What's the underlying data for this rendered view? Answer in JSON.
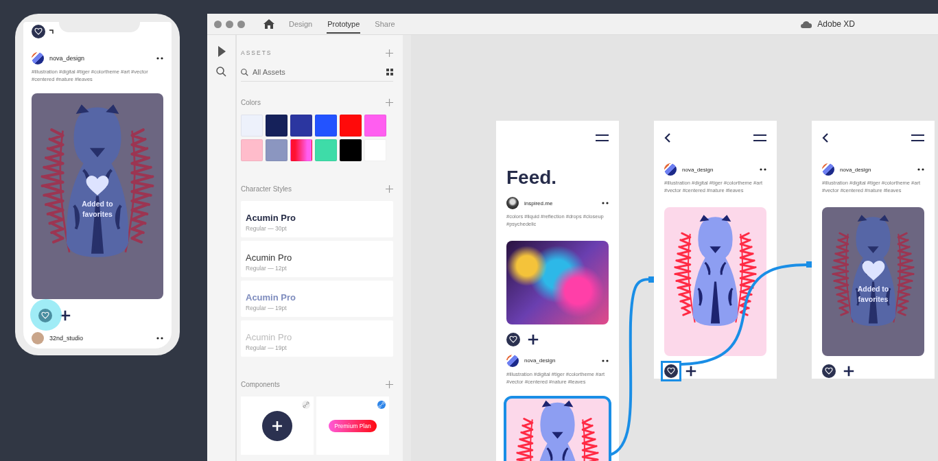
{
  "phone_preview": {
    "post": {
      "username": "nova_design",
      "hashtags": "#illustration #digital #tiger #colortheme #art #vector #centered #nature #leaves",
      "favorited": true,
      "overlay_text": "Added to favorites"
    },
    "next_post": {
      "username": "32nd_studio"
    }
  },
  "window": {
    "tabs": [
      {
        "label": "Design",
        "selected": false
      },
      {
        "label": "Prototype",
        "selected": true
      },
      {
        "label": "Share",
        "selected": false
      }
    ],
    "app_name": "Adobe XD"
  },
  "assets": {
    "title": "ASSETS",
    "search": {
      "placeholder": "All Assets"
    },
    "colors": {
      "title": "Colors",
      "swatches": [
        {
          "color": "#edf1fb"
        },
        {
          "color": "#15215a"
        },
        {
          "color": "#2b36a0"
        },
        {
          "color": "#2353ff"
        },
        {
          "color": "#ff0a0a"
        },
        {
          "color": "#ff5ef0"
        },
        {
          "color": "#ffbccb"
        },
        {
          "color": "#8b96c0"
        },
        {
          "gradient": [
            {
              "color": "#ff1030"
            },
            {
              "color": "#ff5ef0"
            }
          ]
        },
        {
          "color": "#3edca8"
        },
        {
          "color": "#000000"
        },
        {
          "color": "#ffffff"
        }
      ]
    },
    "character_styles": {
      "title": "Character Styles",
      "items": [
        {
          "kind": "bold",
          "name": "Acumin Pro",
          "detail": "Regular — 30pt"
        },
        {
          "kind": "regular",
          "name": "Acumin Pro",
          "detail": "Regular — 12pt"
        },
        {
          "kind": "accent",
          "name": "Acumin Pro",
          "detail": "Regular — 19pt"
        },
        {
          "kind": "light",
          "name": "Acumin Pro",
          "detail": "Regular — 19pt"
        }
      ]
    },
    "components": {
      "title": "Components",
      "items": [
        {
          "kind": "add-button",
          "linked": false
        },
        {
          "kind": "badge",
          "label": "Premium Plan",
          "linked": true
        }
      ]
    }
  },
  "artboards": [
    {
      "kind": "feed",
      "title": "Feed.",
      "posts": [
        {
          "username": "inspired.me",
          "hashtags": "#colors #liquid #reflection #drops #closeup #psychedelic",
          "kind": "photo",
          "favorited": false,
          "selected": false
        },
        {
          "username": "nova_design",
          "hashtags": "#illustration #digital #tiger #colortheme #art #vector #centered #nature #leaves",
          "kind": "illustration",
          "favorited": false,
          "selected": true
        }
      ]
    },
    {
      "kind": "detail",
      "post": {
        "username": "nova_design",
        "hashtags": "#illustration #digital #tiger #colortheme #art #vector #centered #nature #leaves",
        "favorited": false,
        "trigger_selected": true
      }
    },
    {
      "kind": "detail",
      "post": {
        "username": "nova_design",
        "hashtags": "#illustration #digital #tiger #colortheme #art #vector #centered #nature #leaves",
        "favorited": true,
        "overlay_text": "Added to favorites",
        "trigger_selected": false
      }
    }
  ]
}
